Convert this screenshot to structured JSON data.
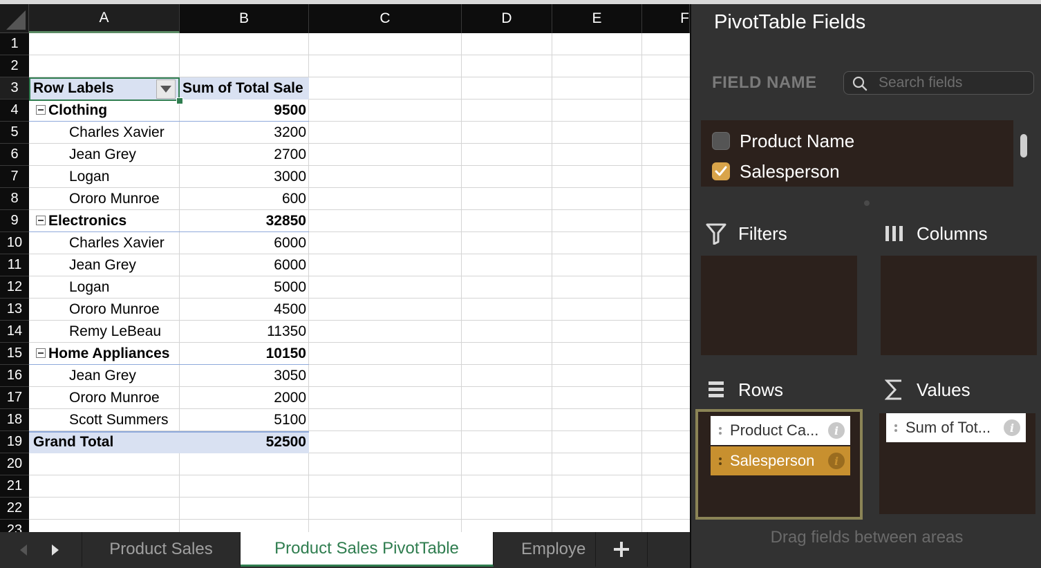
{
  "spreadsheet": {
    "columns": [
      "A",
      "B",
      "C",
      "D",
      "E",
      "F"
    ],
    "rows": [
      "1",
      "2",
      "3",
      "4",
      "5",
      "6",
      "7",
      "8",
      "9",
      "10",
      "11",
      "12",
      "13",
      "14",
      "15",
      "16",
      "17",
      "18",
      "19",
      "20",
      "21",
      "22",
      "23"
    ],
    "pivot": {
      "header_label": "Row Labels",
      "header_value": "Sum of Total Sale",
      "groups": [
        {
          "label": "Clothing",
          "total": "9500",
          "items": [
            {
              "name": "Charles Xavier",
              "value": "3200"
            },
            {
              "name": "Jean Grey",
              "value": "2700"
            },
            {
              "name": "Logan",
              "value": "3000"
            },
            {
              "name": "Ororo Munroe",
              "value": "600"
            }
          ]
        },
        {
          "label": "Electronics",
          "total": "32850",
          "items": [
            {
              "name": "Charles Xavier",
              "value": "6000"
            },
            {
              "name": "Jean Grey",
              "value": "6000"
            },
            {
              "name": "Logan",
              "value": "5000"
            },
            {
              "name": "Ororo Munroe",
              "value": "4500"
            },
            {
              "name": "Remy LeBeau",
              "value": "11350"
            }
          ]
        },
        {
          "label": "Home Appliances",
          "total": "10150",
          "items": [
            {
              "name": "Jean Grey",
              "value": "3050"
            },
            {
              "name": "Ororo Munroe",
              "value": "2000"
            },
            {
              "name": "Scott Summers",
              "value": "5100"
            }
          ]
        }
      ],
      "grand_total_label": "Grand Total",
      "grand_total_value": "52500"
    }
  },
  "sheet_tabs": {
    "tabs": [
      {
        "label": "Product Sales",
        "active": false
      },
      {
        "label": "Product Sales PivotTable",
        "active": true
      },
      {
        "label": "Employe",
        "active": false
      }
    ],
    "add_label": "+"
  },
  "pivot_panel": {
    "title": "PivotTable Fields",
    "field_name_label": "FIELD NAME",
    "search_placeholder": "Search fields",
    "fields": [
      {
        "name": "Product Name",
        "checked": false
      },
      {
        "name": "Salesperson",
        "checked": true
      }
    ],
    "zones": {
      "filters": "Filters",
      "columns": "Columns",
      "rows": "Rows",
      "values": "Values"
    },
    "rows_items": [
      "Product Ca...",
      "Salesperson"
    ],
    "values_items": [
      "Sum of Tot..."
    ],
    "hint": "Drag fields between areas",
    "colors": {
      "accent": "#c8902f",
      "zone_bg": "#2c211c",
      "panel_bg": "#323232",
      "sheet_green": "#2f7d4f"
    }
  }
}
